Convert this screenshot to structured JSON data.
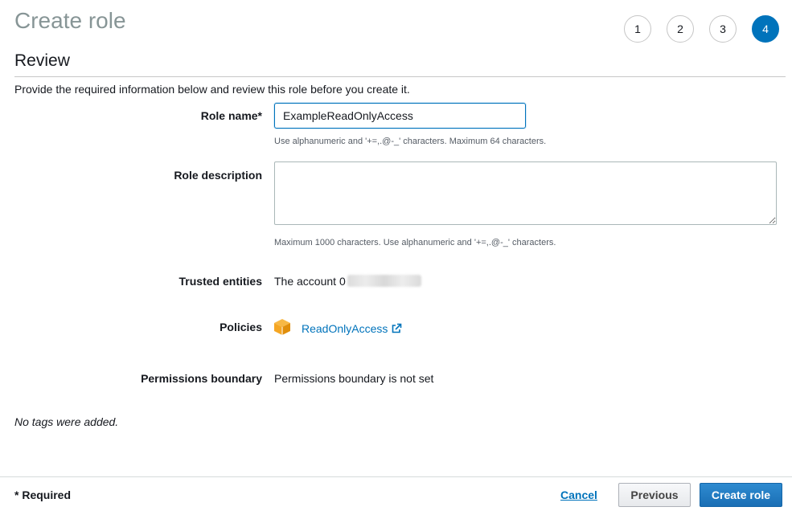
{
  "header": {
    "title": "Create role"
  },
  "steps": [
    "1",
    "2",
    "3",
    "4"
  ],
  "section": {
    "title": "Review",
    "intro": "Provide the required information below and review this role before you create it."
  },
  "form": {
    "role_name_label": "Role name*",
    "role_name_value": "ExampleReadOnlyAccess",
    "role_name_hint": "Use alphanumeric and '+=,.@-_' characters. Maximum 64 characters.",
    "description_label": "Role description",
    "description_value": "",
    "description_hint": "Maximum 1000 characters. Use alphanumeric and '+=,.@-_' characters.",
    "trusted_label": "Trusted entities",
    "trusted_value": "The account 0",
    "policies_label": "Policies",
    "policy_name": "ReadOnlyAccess",
    "boundary_label": "Permissions boundary",
    "boundary_value": "Permissions boundary is not set"
  },
  "tags_note": "No tags were added.",
  "footer": {
    "required": "* Required",
    "cancel": "Cancel",
    "previous": "Previous",
    "create": "Create role"
  },
  "colors": {
    "accent": "#0073bb",
    "primary_button": "#1a6fb5",
    "policy_icon": "#f5a623"
  },
  "icons": {
    "policy": "aws-managed-policy-cube-icon",
    "external": "external-link-icon"
  }
}
